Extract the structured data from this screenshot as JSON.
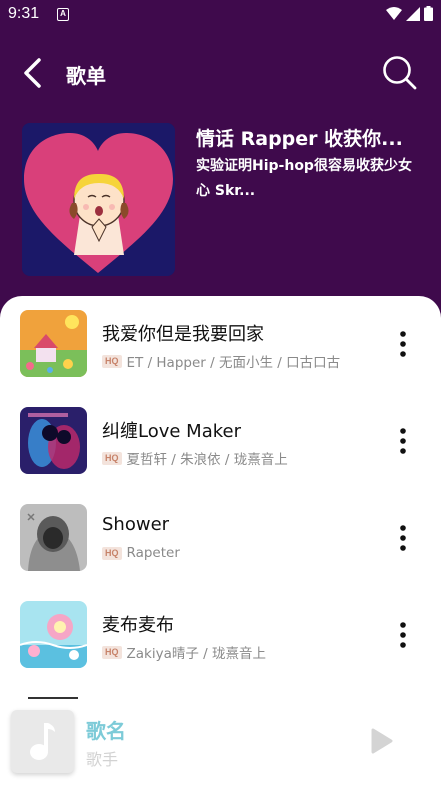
{
  "status": {
    "time": "9:31",
    "notification_icon": "a-notification-icon",
    "icons": [
      "wifi-icon",
      "signal-icon",
      "battery-icon"
    ]
  },
  "header": {
    "title": "歌单",
    "back_icon": "chevron-left-icon",
    "search_icon": "search-icon"
  },
  "playlist": {
    "title": "情话 Rapper 收获你...",
    "description": "实验证明Hip-hop很容易收获少女心 Skr..."
  },
  "songs": [
    {
      "title": "我爱你但是我要回家",
      "badge": "HQ",
      "artists": "ET / Happer / 无面小生 / 口古口古"
    },
    {
      "title": "纠缠Love Maker",
      "badge": "HQ",
      "artists": "夏哲轩 / 朱浪依 / 珑熹音上"
    },
    {
      "title": "Shower",
      "badge": "HQ",
      "artists": "Rapeter"
    },
    {
      "title": "麦布麦布",
      "badge": "HQ",
      "artists": "Zakiya晴子 / 珑熹音上"
    }
  ],
  "player": {
    "song_name": "歌名",
    "artist": "歌手",
    "music_icon": "music-note-icon",
    "play_icon": "play-icon"
  },
  "colors": {
    "header_bg": "#3f0a4c",
    "accent": "#7dcbd8",
    "badge": "#c7836a"
  }
}
